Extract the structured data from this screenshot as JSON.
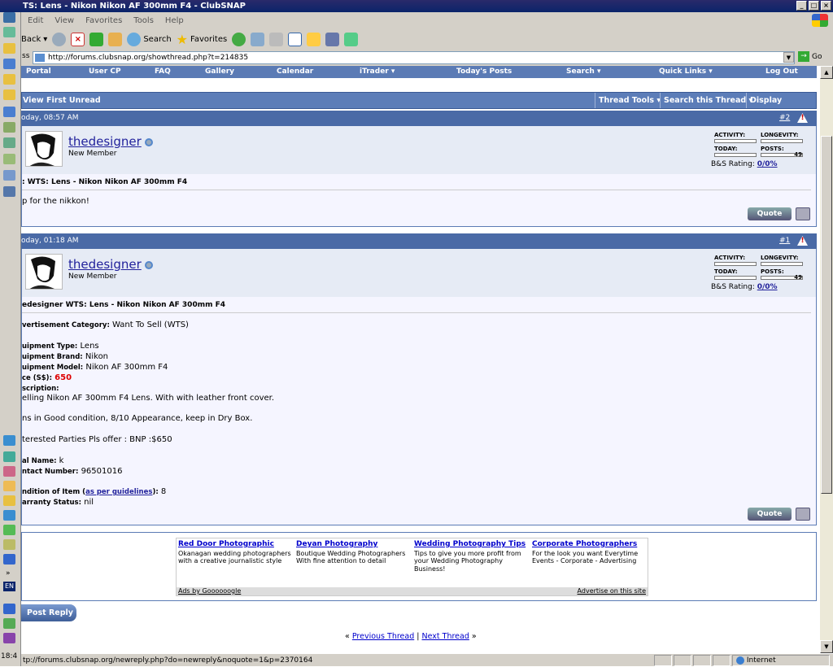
{
  "window": {
    "title": "TS: Lens - Nikon Nikon AF 300mm F4 - ClubSNAP"
  },
  "menu": [
    "Edit",
    "View",
    "Favorites",
    "Tools",
    "Help"
  ],
  "toolbar": {
    "back": "Back",
    "search": "Search",
    "favorites": "Favorites"
  },
  "address": {
    "label": "ss",
    "url": "http://forums.clubsnap.org/showthread.php?t=214835",
    "go": "Go"
  },
  "nav": [
    "Portal",
    "User CP",
    "FAQ",
    "Gallery",
    "Calendar",
    "iTrader ▾",
    "Today's Posts",
    "Search ▾",
    "Quick Links ▾",
    "Log Out"
  ],
  "threadbar": {
    "view_first": "View First Unread",
    "tools": "Thread Tools ▾",
    "search": "Search this Thread ▾",
    "modes": "Display Modes ▾"
  },
  "posts": [
    {
      "time": "oday, 08:57 AM",
      "num": "#2",
      "user": "thedesigner",
      "user_title": "New Member",
      "bs_label": "B&S Rating:",
      "bs_value": "0/0%",
      "posts_count": "49",
      "title": ": WTS: Lens - Nikon Nikon AF 300mm F4",
      "text": "p for the nikkon!",
      "quote": "Quote"
    },
    {
      "time": "oday, 01:18 AM",
      "num": "#1",
      "user": "thedesigner",
      "user_title": "New Member",
      "bs_label": "B&S Rating:",
      "bs_value": "0/0%",
      "posts_count": "49",
      "title": "edesigner WTS: Lens - Nikon Nikon AF 300mm F4",
      "quote": "Quote",
      "fields": {
        "cat_label": "vertisement Category:",
        "cat": "Want To Sell (WTS)",
        "type_label": "uipment Type:",
        "type": "Lens",
        "brand_label": "uipment Brand:",
        "brand": "Nikon",
        "model_label": "uipment Model:",
        "model": "Nikon AF 300mm F4",
        "price_label": "ce (S$):",
        "price": "650",
        "desc_label": "scription:",
        "desc1": "elling Nikon AF 300mm F4 Lens. With with leather front cover.",
        "desc2": "ns in Good condition, 8/10 Appearance, keep in Dry Box.",
        "desc3": "terested Parties Pls offer : BNP :$650",
        "name_label": "al Name:",
        "name": "k",
        "contact_label": "ntact Number:",
        "contact": "96501016",
        "cond_label": "ndition of Item (",
        "cond_link": "as per guidelines",
        "cond_label2": "):",
        "cond": "8",
        "warranty_label": "arranty Status:",
        "warranty": "nil"
      }
    }
  ],
  "stat_labels": {
    "activity": "ACTIVITY:",
    "longevity": "LONGEVITY:",
    "today": "TODAY:",
    "posts": "POSTS:"
  },
  "ads": [
    {
      "title": "Red Door Photographic",
      "text": "Okanagan wedding photographers with a creative journalistic style"
    },
    {
      "title": "Deyan Photography",
      "text": "Boutique Wedding Photographers With fine attention to detail"
    },
    {
      "title": "Wedding Photography Tips",
      "text": "Tips to give you more profit from your Wedding Photography Business!"
    },
    {
      "title": "Corporate Photographers",
      "text": "For the look you want Everytime Events - Corporate - Advertising"
    }
  ],
  "ads_by": "Ads by Goooooogle",
  "advertise": "Advertise on this site",
  "post_reply": "Post Reply",
  "threadnav": {
    "prev": "Previous Thread",
    "next": "Next Thread",
    "sep": "|",
    "l": "«",
    "r": "»"
  },
  "status": {
    "url": "tp://forums.clubsnap.org/newreply.php?do=newreply&noquote=1&p=2370164",
    "zone": "Internet"
  },
  "tray": {
    "lang": "EN",
    "clock": "18:4"
  }
}
